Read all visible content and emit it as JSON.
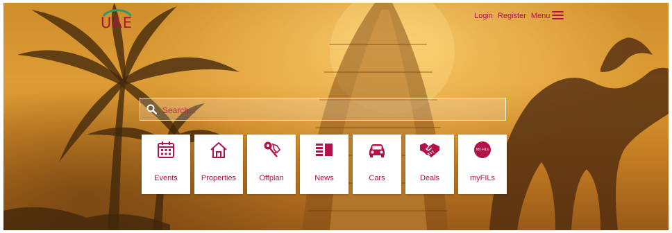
{
  "logo": {
    "text": "UAE"
  },
  "nav": {
    "login": "Login",
    "register": "Register",
    "menu": "Menu"
  },
  "search": {
    "placeholder": "Search..."
  },
  "tiles": [
    {
      "label": "Events",
      "icon": "calendar-icon"
    },
    {
      "label": "Properties",
      "icon": "house-icon"
    },
    {
      "label": "Offplan",
      "icon": "keys-icon"
    },
    {
      "label": "News",
      "icon": "newspaper-icon"
    },
    {
      "label": "Cars",
      "icon": "car-icon"
    },
    {
      "label": "Deals",
      "icon": "handshake-icon"
    },
    {
      "label": "myFILs",
      "icon": "myfils-badge-icon",
      "badge": "My FILs"
    }
  ],
  "colors": {
    "accent": "#b2124a",
    "logo_arc": "#2e9a6a"
  }
}
